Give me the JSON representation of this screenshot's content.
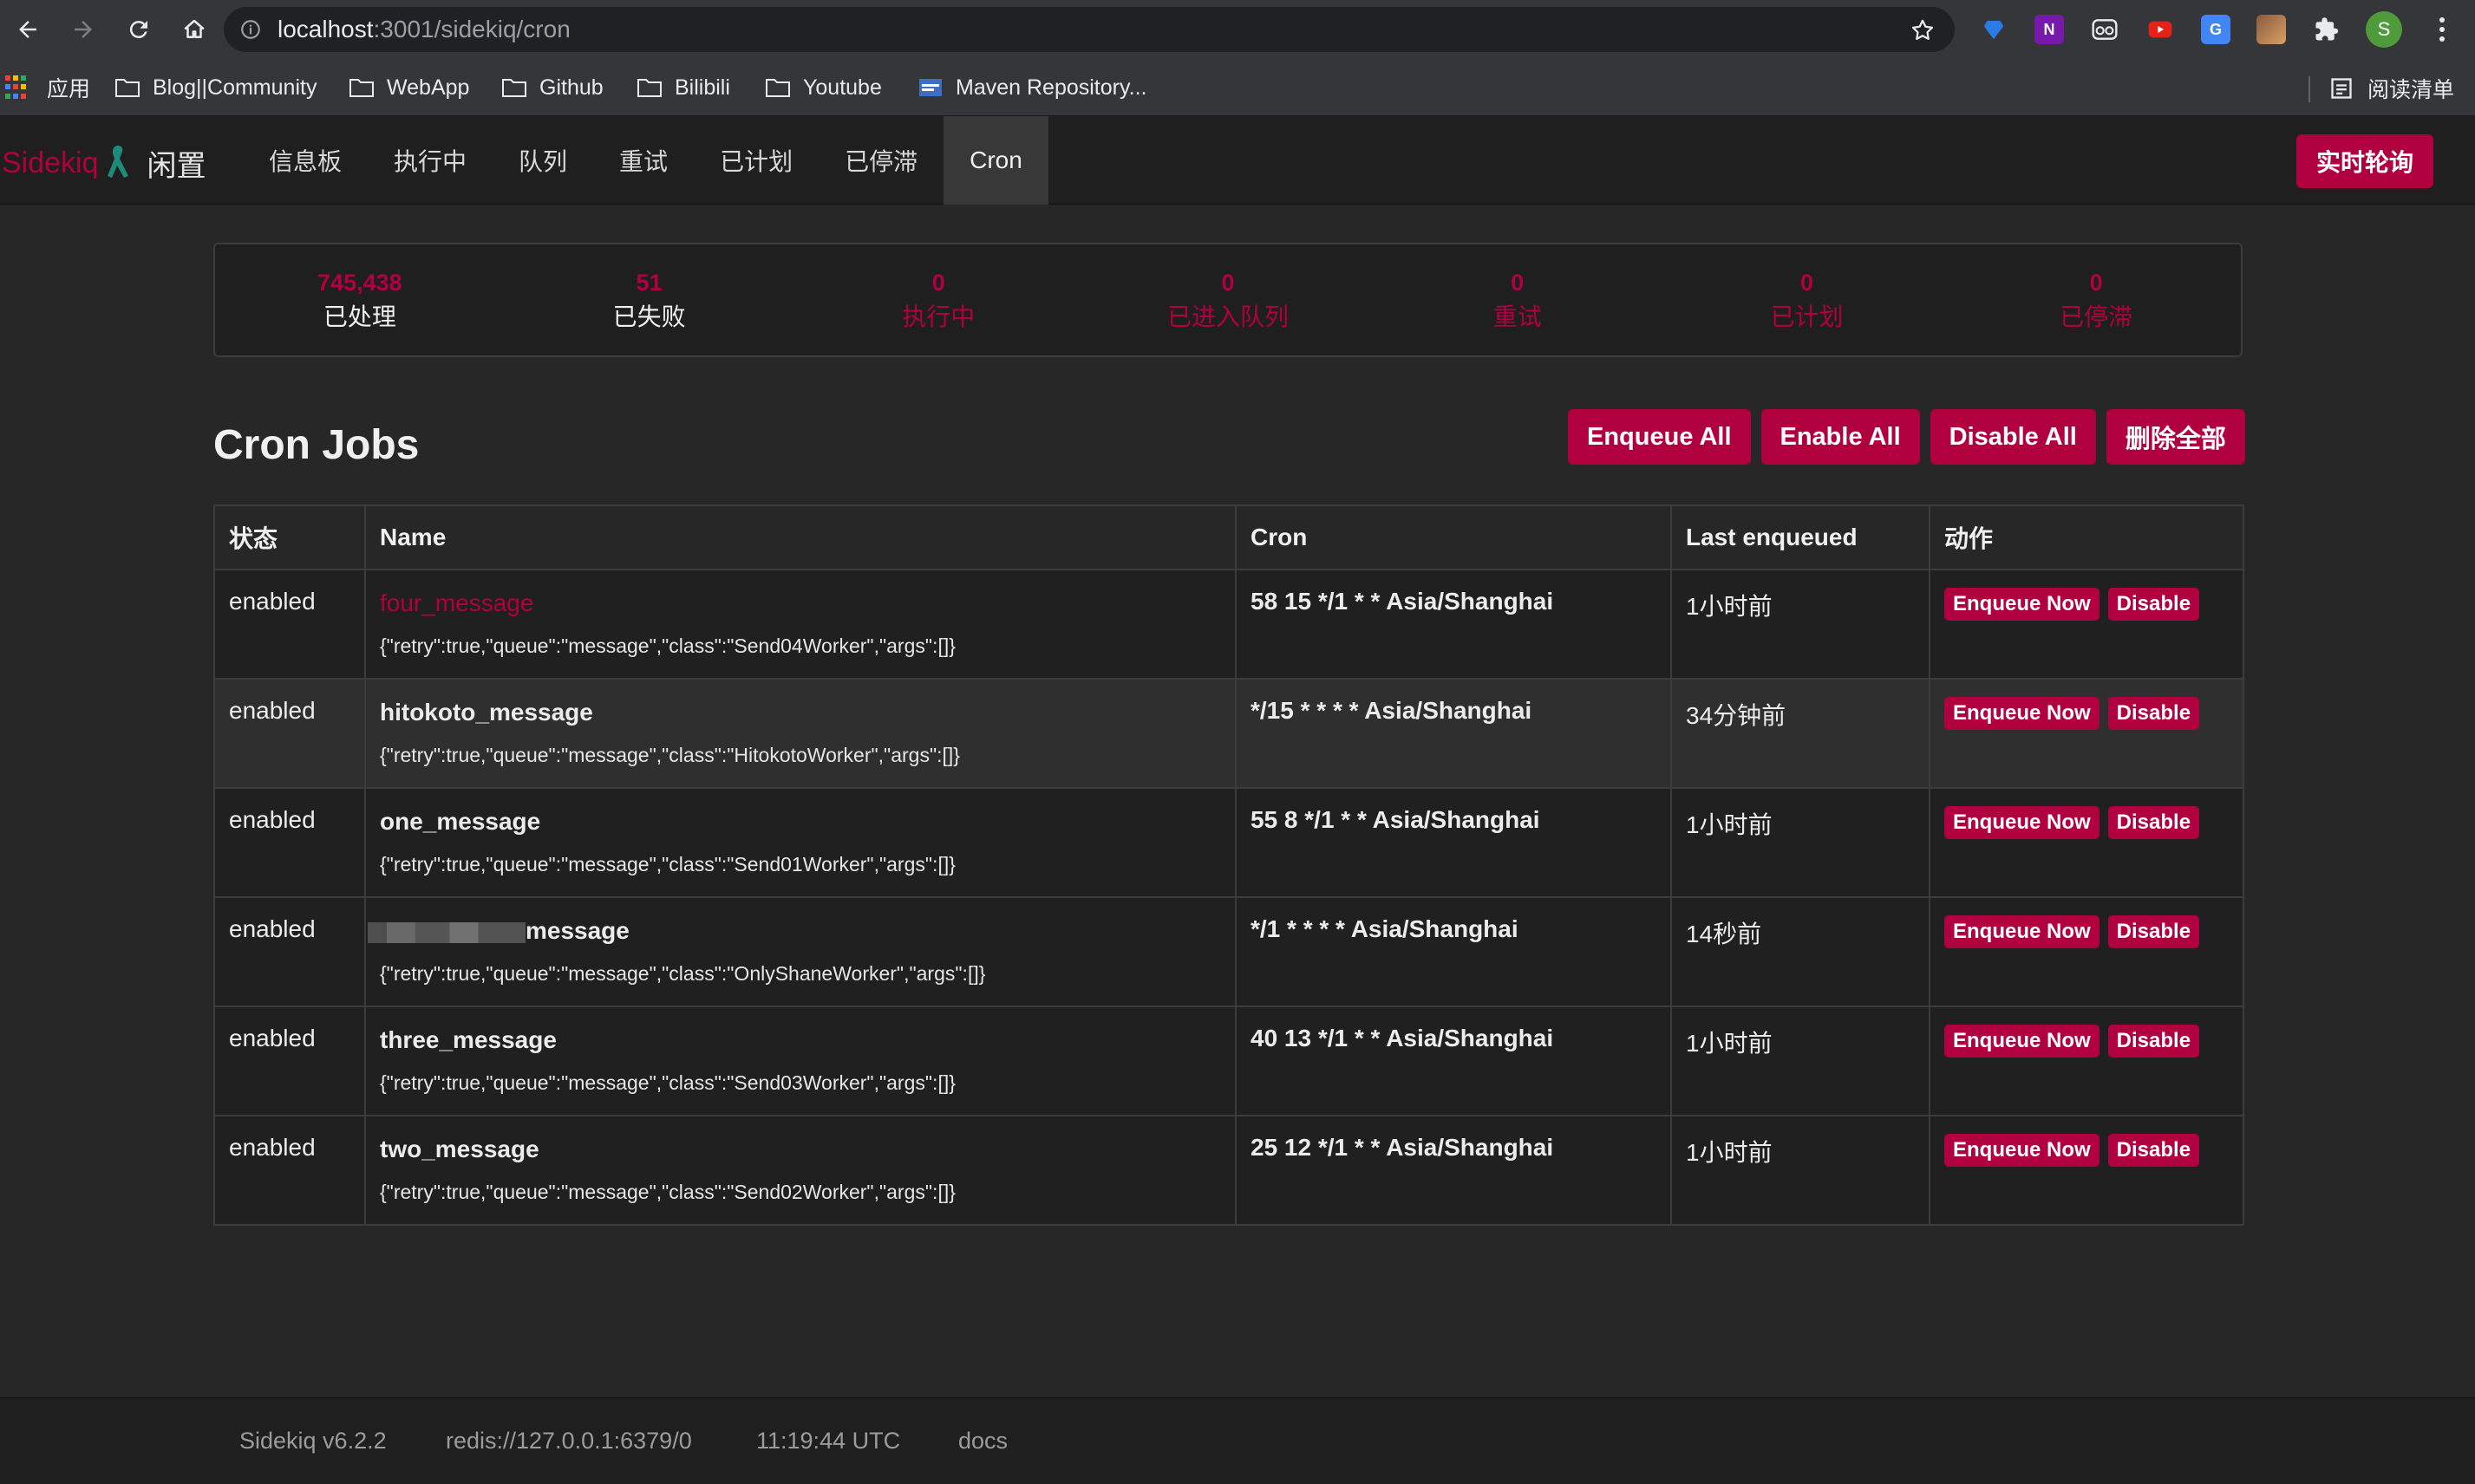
{
  "browser": {
    "url_host": "localhost",
    "url_path": ":3001/sidekiq/cron",
    "bookmarks": [
      "应用",
      "Blog||Community",
      "WebApp",
      "Github",
      "Bilibili",
      "Youtube",
      "Maven Repository..."
    ],
    "reading_list": "阅读清单",
    "profile_initial": "S"
  },
  "nav": {
    "brand": "Sidekiq",
    "status": "闲置",
    "items": [
      "信息板",
      "执行中",
      "队列",
      "重试",
      "已计划",
      "已停滞",
      "Cron"
    ],
    "active": "Cron",
    "live_poll": "实时轮询"
  },
  "summary": [
    {
      "count": "745,438",
      "label": "已处理"
    },
    {
      "count": "51",
      "label": "已失败"
    },
    {
      "count": "0",
      "label": "执行中"
    },
    {
      "count": "0",
      "label": "已进入队列"
    },
    {
      "count": "0",
      "label": "重试"
    },
    {
      "count": "0",
      "label": "已计划"
    },
    {
      "count": "0",
      "label": "已停滞"
    }
  ],
  "page": {
    "title": "Cron Jobs",
    "actions": [
      "Enqueue All",
      "Enable All",
      "Disable All",
      "删除全部"
    ]
  },
  "table": {
    "headers": [
      "状态",
      "Name",
      "Cron",
      "Last enqueued",
      "动作"
    ],
    "rows": [
      {
        "status": "enabled",
        "name": "four_message",
        "args": "{\"retry\":true,\"queue\":\"message\",\"class\":\"Send04Worker\",\"args\":[]}",
        "cron": "58 15 */1 * * Asia/Shanghai",
        "last": "1小时前"
      },
      {
        "status": "enabled",
        "name": "hitokoto_message",
        "args": "{\"retry\":true,\"queue\":\"message\",\"class\":\"HitokotoWorker\",\"args\":[]}",
        "cron": "*/15 * * * * Asia/Shanghai",
        "last": "34分钟前"
      },
      {
        "status": "enabled",
        "name": "one_message",
        "args": "{\"retry\":true,\"queue\":\"message\",\"class\":\"Send01Worker\",\"args\":[]}",
        "cron": "55 8 */1 * * Asia/Shanghai",
        "last": "1小时前"
      },
      {
        "status": "enabled",
        "name": "message",
        "args": "{\"retry\":true,\"queue\":\"message\",\"class\":\"OnlyShaneWorker\",\"args\":[]}",
        "cron": "*/1 * * * * Asia/Shanghai",
        "last": "14秒前"
      },
      {
        "status": "enabled",
        "name": "three_message",
        "args": "{\"retry\":true,\"queue\":\"message\",\"class\":\"Send03Worker\",\"args\":[]}",
        "cron": "40 13 */1 * * Asia/Shanghai",
        "last": "1小时前"
      },
      {
        "status": "enabled",
        "name": "two_message",
        "args": "{\"retry\":true,\"queue\":\"message\",\"class\":\"Send02Worker\",\"args\":[]}",
        "cron": "25 12 */1 * * Asia/Shanghai",
        "last": "1小时前"
      }
    ],
    "row_actions": [
      "Enqueue Now",
      "Disable"
    ]
  },
  "footer": {
    "version": "Sidekiq v6.2.2",
    "redis": "redis://127.0.0.1:6379/0",
    "time": "11:19:44 UTC",
    "docs": "docs"
  },
  "colors": {
    "accent": "#b1003e",
    "background": "#272727",
    "nav": "#1f1f1f"
  }
}
